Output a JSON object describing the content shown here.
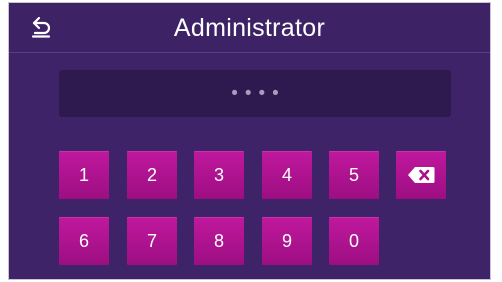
{
  "header": {
    "title": "Administrator",
    "back_icon": "back-arrow-icon"
  },
  "pin": {
    "masked_value": "••••"
  },
  "keypad": {
    "keys": [
      "1",
      "2",
      "3",
      "4",
      "5",
      "6",
      "7",
      "8",
      "9",
      "0"
    ],
    "backspace_icon": "backspace-icon"
  },
  "colors": {
    "background": "#3e2368",
    "display": "#2e1a4e",
    "key": "#b0138f",
    "text": "#ffffff"
  }
}
